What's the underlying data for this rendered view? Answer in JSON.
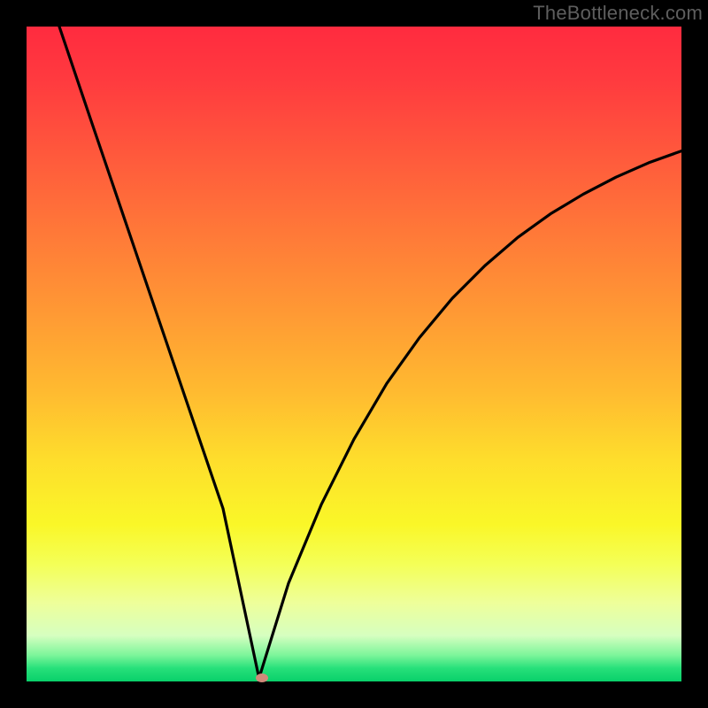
{
  "watermark": "TheBottleneck.com",
  "chart_data": {
    "type": "line",
    "title": "",
    "xlabel": "",
    "ylabel": "",
    "xlim": [
      0,
      100
    ],
    "ylim": [
      0,
      100
    ],
    "series": [
      {
        "name": "curve",
        "x": [
          5,
          10,
          15,
          20,
          25,
          30,
          35.5,
          40,
          45,
          50,
          55,
          60,
          65,
          70,
          75,
          80,
          85,
          90,
          95,
          100
        ],
        "values": [
          100,
          85.2,
          70.5,
          55.8,
          41.1,
          26.4,
          0.5,
          15,
          27,
          37,
          45.5,
          52.5,
          58.5,
          63.5,
          67.8,
          71.4,
          74.4,
          77,
          79.2,
          81
        ]
      }
    ],
    "marker": {
      "x": 36,
      "y": 0.5,
      "color": "#d08a7a"
    },
    "background_gradient": {
      "top": "#ff2b3f",
      "middle": "#ffbb30",
      "bottom": "#09d06a"
    },
    "grid": false,
    "legend": false
  }
}
